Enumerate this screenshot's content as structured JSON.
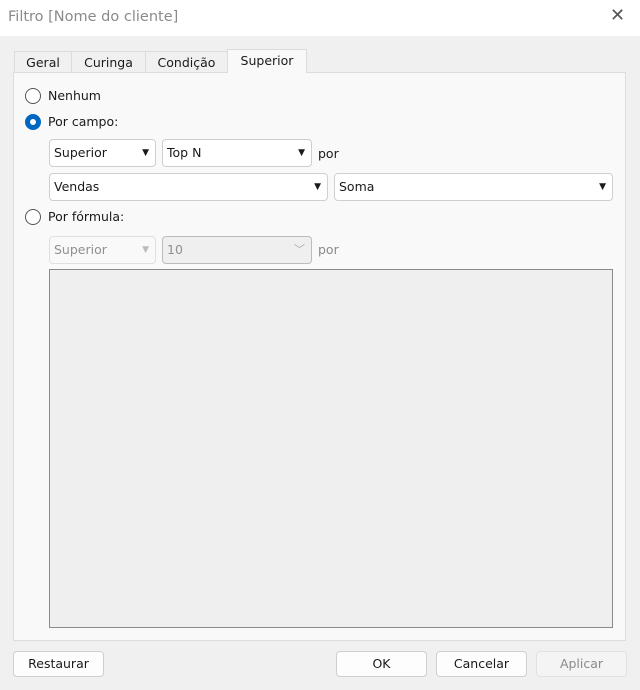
{
  "window": {
    "title": "Filtro [Nome do cliente]",
    "close_icon": "close-icon"
  },
  "tabs": [
    {
      "label": "Geral"
    },
    {
      "label": "Curinga"
    },
    {
      "label": "Condição"
    },
    {
      "label": "Superior",
      "selected": true
    }
  ],
  "options": {
    "none": "Nenhum",
    "by_field": "Por campo:",
    "by_formula": "Por fórmula:",
    "selected": "by_field"
  },
  "by_field": {
    "direction": "Superior",
    "mode": "Top N",
    "por": "por",
    "field": "Vendas",
    "aggregation": "Soma"
  },
  "by_formula": {
    "direction": "Superior",
    "value": "10",
    "por": "por",
    "formula": ""
  },
  "buttons": {
    "reset": "Restaurar",
    "ok": "OK",
    "cancel": "Cancelar",
    "apply": "Aplicar"
  },
  "colors": {
    "accent": "#0067c0"
  }
}
